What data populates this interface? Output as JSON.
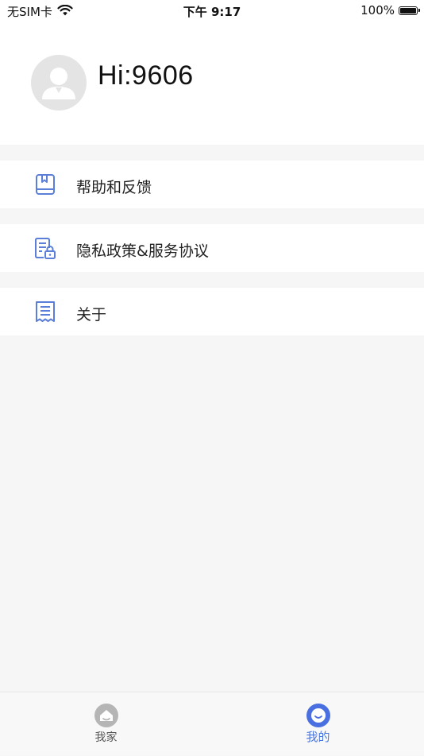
{
  "status_bar": {
    "carrier": "无SIM卡",
    "time": "下午 9:17",
    "battery": "100%"
  },
  "profile": {
    "greeting": "Hi:9606"
  },
  "menu": {
    "items": [
      {
        "label": "帮助和反馈",
        "icon": "help-book-icon"
      },
      {
        "label": "隐私政策&服务协议",
        "icon": "privacy-document-icon"
      },
      {
        "label": "关于",
        "icon": "about-document-icon"
      }
    ]
  },
  "tab_bar": {
    "tabs": [
      {
        "label": "我家",
        "icon": "home-icon",
        "active": false
      },
      {
        "label": "我的",
        "icon": "profile-icon",
        "active": true
      }
    ]
  },
  "colors": {
    "accent": "#4a76e0",
    "icon_blue": "#5b7fd8",
    "background": "#f6f6f6"
  }
}
